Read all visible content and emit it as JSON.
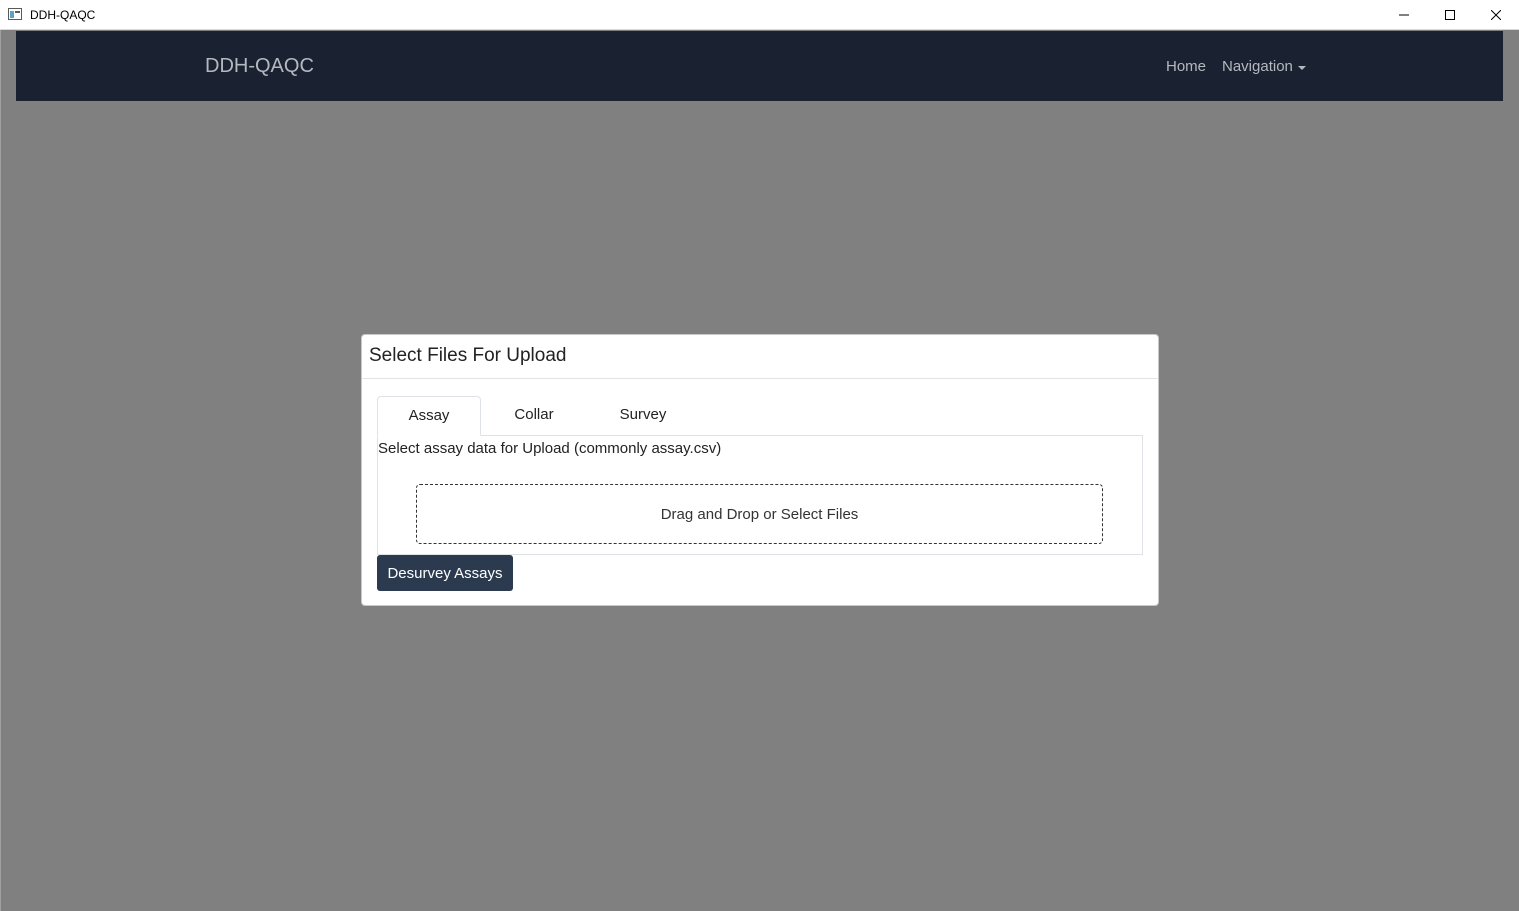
{
  "window": {
    "title": "DDH-QAQC"
  },
  "navbar": {
    "brand": "DDH-QAQC",
    "links": [
      "Home",
      "Navigation"
    ]
  },
  "modal": {
    "title": "Select Files For Upload",
    "tabs": [
      {
        "label": "Assay",
        "active": true
      },
      {
        "label": "Collar",
        "active": false
      },
      {
        "label": "Survey",
        "active": false
      }
    ],
    "panel_description": "Select assay data for Upload (commonly assay.csv)",
    "dropzone_label": "Drag and Drop or Select Files",
    "action_button": "Desurvey Assays"
  },
  "colors": {
    "navbar_bg": "#1a2130",
    "overlay": "#808080",
    "button_bg": "#2c3a50"
  }
}
